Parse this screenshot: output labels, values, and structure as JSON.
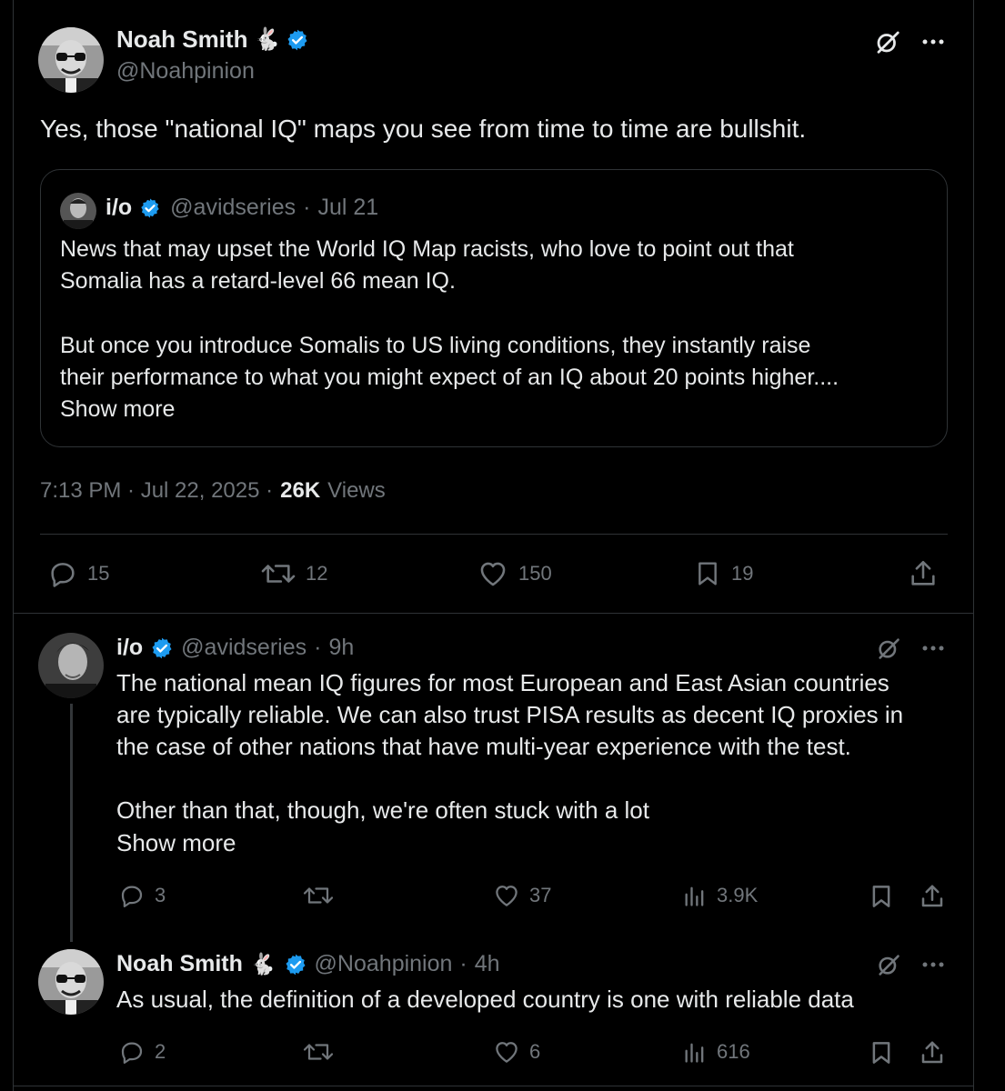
{
  "main_tweet": {
    "author_name": "Noah Smith",
    "author_emoji": "🐇",
    "handle": "@Noahpinion",
    "text": "Yes, those \"national IQ\" maps you see from time to time are bullshit.",
    "quote": {
      "author_name": "i/o",
      "handle": "@avidseries",
      "sep": "·",
      "date": "Jul 21",
      "line1": "News that may upset the World IQ Map racists, who love to point out that",
      "line2": "Somalia has a retard-level 66 mean IQ.",
      "line3": "But once you introduce Somalis to US living conditions, they instantly raise",
      "line4": "their performance to what you might expect of an IQ about 20 points higher....",
      "show_more": "Show more"
    },
    "timestamp": "7:13 PM · Jul 22, 2025 ·",
    "views_count": "26K",
    "views_label": "Views",
    "stats": {
      "replies": "15",
      "reposts": "12",
      "likes": "150",
      "bookmarks": "19"
    }
  },
  "replies": [
    {
      "author_name": "i/o",
      "handle": "@avidseries",
      "sep": "·",
      "time": "9h",
      "line1": "The national mean IQ figures for most European and East Asian countries",
      "line2": "are typically reliable. We can also trust PISA results as decent IQ proxies in",
      "line3": "the case of other nations that have multi-year experience with the test.",
      "line4": "Other than that, though, we're often stuck with a lot",
      "show_more": "Show more",
      "stats": {
        "replies": "3",
        "likes": "37",
        "views": "3.9K"
      }
    },
    {
      "author_name": "Noah Smith",
      "author_emoji": "🐇",
      "handle": "@Noahpinion",
      "sep": "·",
      "time": "4h",
      "text": "As usual, the definition of a developed country is one with reliable data",
      "stats": {
        "replies": "2",
        "likes": "6",
        "views": "616"
      }
    }
  ],
  "colors": {
    "background": "#000000",
    "text": "#e7e9ea",
    "muted": "#71767b",
    "accent": "#1d9bf0",
    "border": "#2f3336"
  }
}
